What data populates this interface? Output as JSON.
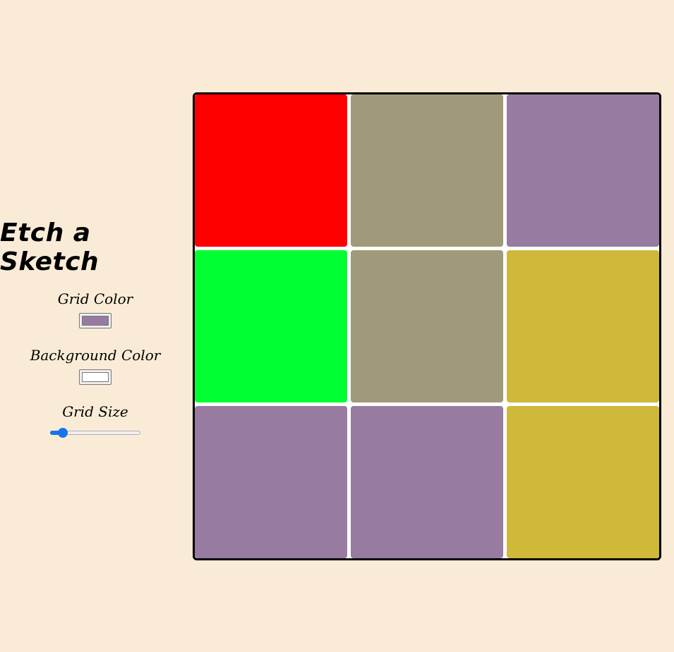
{
  "app": {
    "title": "Etch a Sketch"
  },
  "controls": {
    "grid_color_label": "Grid Color",
    "grid_color_value": "#987ba1",
    "background_color_label": "Background Color",
    "background_color_value": "#ffffff",
    "grid_size_label": "Grid Size",
    "grid_size_fraction": 0.1
  },
  "colors": {
    "page_background": "#faebd7",
    "slider_accent": "#1a73e8"
  },
  "grid": {
    "size": 3,
    "cells": [
      "#ff0000",
      "#a09a7a",
      "#987ba1",
      "#00ff33",
      "#a09a7a",
      "#cfb83a",
      "#987ba1",
      "#987ba1",
      "#cfb83a"
    ]
  }
}
